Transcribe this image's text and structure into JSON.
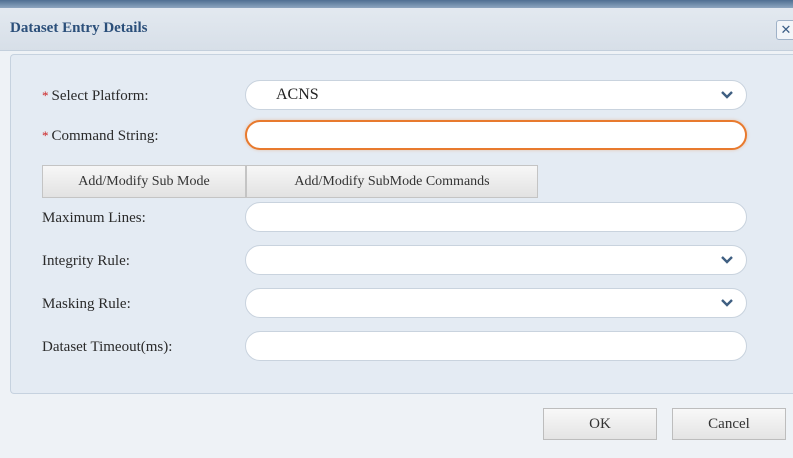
{
  "dialog": {
    "title": "Dataset Entry Details",
    "close_glyph": "✕"
  },
  "form": {
    "platform": {
      "required_mark": "*",
      "label": "Select Platform:",
      "value": "ACNS"
    },
    "command": {
      "required_mark": "*",
      "label": "Command String:",
      "value": ""
    },
    "sub_mode_button": "Add/Modify Sub Mode",
    "sub_mode_commands_button": "Add/Modify SubMode Commands",
    "max_lines": {
      "label": "Maximum Lines:",
      "value": ""
    },
    "integrity_rule": {
      "label": "Integrity Rule:",
      "value": ""
    },
    "masking_rule": {
      "label": "Masking Rule:",
      "value": ""
    },
    "timeout": {
      "label": "Dataset Timeout(ms):",
      "value": ""
    }
  },
  "footer": {
    "ok_label": "OK",
    "cancel_label": "Cancel"
  },
  "colors": {
    "required": "#cc2222",
    "focus_border": "#e87a2e",
    "title": "#2b4f7a"
  }
}
